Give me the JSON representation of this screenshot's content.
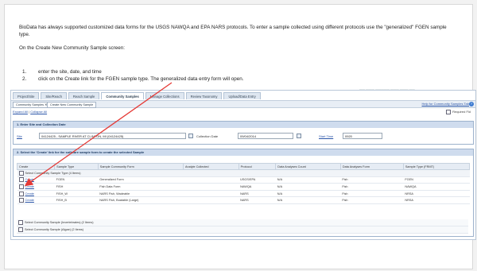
{
  "intro": {
    "paragraph": "BioData has always supported customized data forms for the USGS NAWQA and EPA NARS protocols. To enter a sample collected using different protocols use the \"generalized\" FGEN sample type.",
    "lead": "On the Create New Community Sample screen:",
    "steps": [
      {
        "num": "1.",
        "text": "enter the site, date, and time"
      },
      {
        "num": "2.",
        "text": "click on the Create link for the FGEN sample type. The generalized data entry form will open."
      }
    ]
  },
  "app": {
    "faint_header": "—— ——— ————— ——— ——— ——",
    "tabs": [
      "Project/Site",
      "Site/Reach",
      "Reach Sample",
      "Community Samples",
      "Manage Collections",
      "Review Taxonomy",
      "Upload/Data Entry"
    ],
    "active_tab_index": 3,
    "toolbar": {
      "chip1": "Community Samples ✕",
      "chip2": "Create New Community Sample",
      "help_link": "Help for Community Samples Tab",
      "help_icon": "?"
    },
    "expand_all": "Expand All",
    "collapse_all": "Collapse All",
    "required": "Required Fld",
    "panel1": {
      "title": "1. Enter Site and Collection Date",
      "site_label": "Site",
      "site_value": "04124425 - SAMPLE RIVER AT CLINTON, MI (04124425)",
      "date_label": "Collection Date",
      "date_value": "09/04/2014",
      "time_label": "Start Time",
      "time_value": "0920"
    },
    "panel2": {
      "title": "2. Select the 'Create' link for the software sample form to create the selected Sample",
      "columns": [
        "Create",
        "Sample Type",
        "Sample Community Form",
        "Analyte Collected",
        "Protocol",
        "Data Analyses Count",
        "Data Analyses Form",
        "Sample Type (FRMT)"
      ],
      "group_top": "Select Community Sample Type (4 Items)",
      "rows": [
        {
          "create": "Create",
          "type": "FGEN",
          "form": "Generalized Form",
          "analyte": "",
          "protocol": "USGS/EPA",
          "count": "N/A",
          "dform": "Fish",
          "code": "FGEN"
        },
        {
          "create": "Create",
          "type": "FISH",
          "form": "Fish Data Form",
          "analyte": "",
          "protocol": "NAWQA",
          "count": "N/A",
          "dform": "Fish",
          "code": "NAWQA"
        },
        {
          "create": "Create",
          "type": "FISH_W",
          "form": "NARS Fish, Wadeable",
          "analyte": "",
          "protocol": "NARS",
          "count": "N/A",
          "dform": "Fish",
          "code": "NRSA"
        },
        {
          "create": "Create",
          "type": "FISH_B",
          "form": "NARS Fish, Boatable (Large)",
          "analyte": "",
          "protocol": "NARS",
          "count": "N/A",
          "dform": "Fish",
          "code": "NRSA"
        }
      ],
      "group_bottom_1": "Select Community Sample (Invertebrates) (2 Items)",
      "group_bottom_2": "Select Community Sample (Algae) (2 Items)"
    }
  },
  "colors": {
    "arrow": "#e53935",
    "link": "#2a55a8",
    "panel_header": "#cfdcee"
  }
}
